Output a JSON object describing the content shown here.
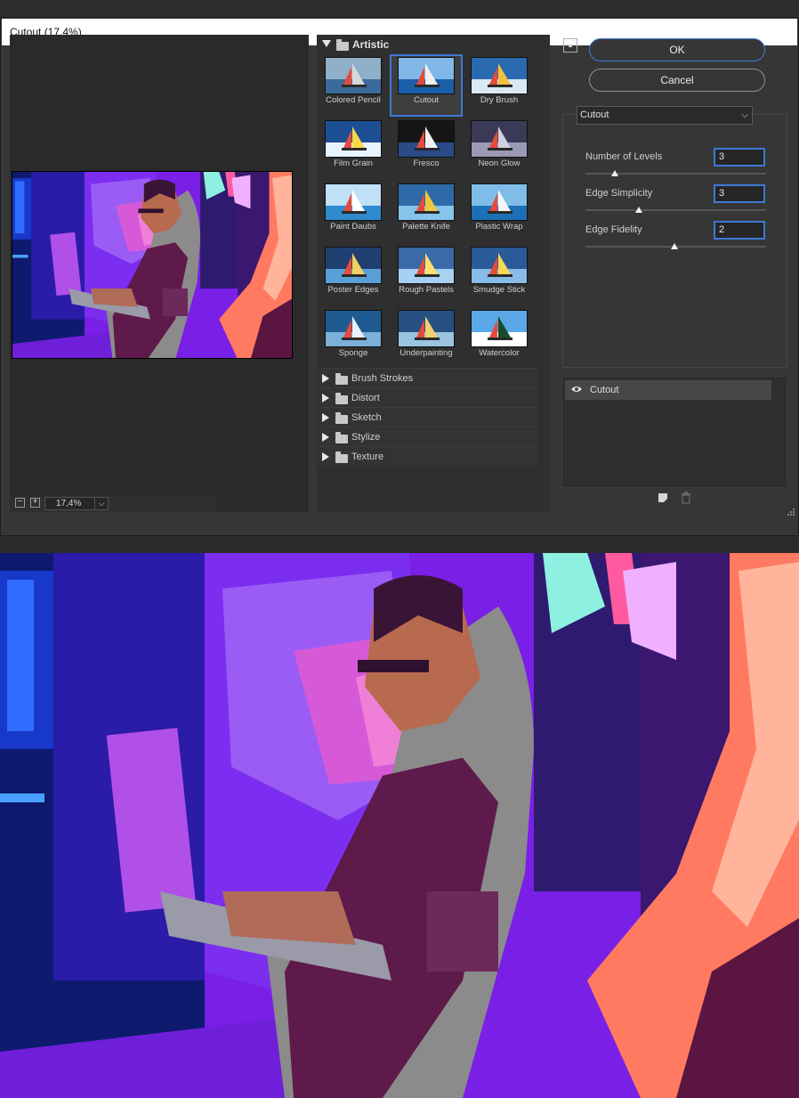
{
  "window": {
    "title": "Cutout (17,4%)"
  },
  "preview": {
    "zoom": "17,4%",
    "zoom_out": "−",
    "zoom_in": "+"
  },
  "gallery": {
    "open_category": "Artistic",
    "filters": [
      {
        "label": "Colored Pencil",
        "selected": false
      },
      {
        "label": "Cutout",
        "selected": true
      },
      {
        "label": "Dry Brush",
        "selected": false
      },
      {
        "label": "Film Grain",
        "selected": false
      },
      {
        "label": "Fresco",
        "selected": false
      },
      {
        "label": "Neon Glow",
        "selected": false
      },
      {
        "label": "Paint Daubs",
        "selected": false
      },
      {
        "label": "Palette Knife",
        "selected": false
      },
      {
        "label": "Plastic Wrap",
        "selected": false
      },
      {
        "label": "Poster Edges",
        "selected": false
      },
      {
        "label": "Rough Pastels",
        "selected": false
      },
      {
        "label": "Smudge Stick",
        "selected": false
      },
      {
        "label": "Sponge",
        "selected": false
      },
      {
        "label": "Underpainting",
        "selected": false
      },
      {
        "label": "Watercolor",
        "selected": false
      }
    ],
    "closed_categories": [
      "Brush Strokes",
      "Distort",
      "Sketch",
      "Stylize",
      "Texture"
    ]
  },
  "actions": {
    "ok_label": "OK",
    "cancel_label": "Cancel"
  },
  "settings": {
    "selected_filter": "Cutout",
    "params": [
      {
        "label": "Number of Levels",
        "value": "3"
      },
      {
        "label": "Edge Simplicity",
        "value": "3"
      },
      {
        "label": "Edge Fidelity",
        "value": "2"
      }
    ]
  },
  "layers": {
    "items": [
      {
        "label": "Cutout",
        "visible": true
      }
    ]
  },
  "icons": [
    "collapse-icon",
    "eye-icon",
    "new-layer-icon",
    "delete-icon",
    "folder-icon",
    "resize-grip-icon"
  ],
  "colors": {
    "accent": "#3d78d6",
    "dialog_bg": "#363636",
    "title_bg": "#ffffff"
  }
}
